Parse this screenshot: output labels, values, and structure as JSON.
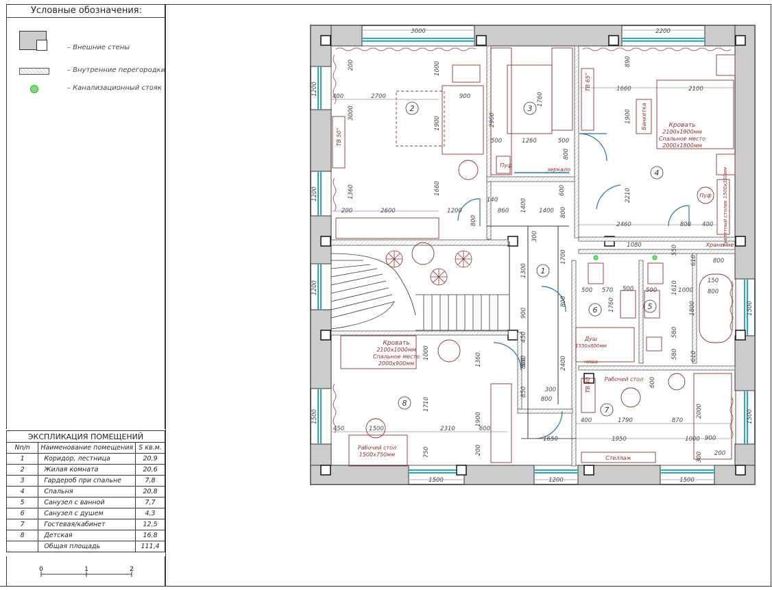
{
  "legend": {
    "title": "Условные обозначения:",
    "items": [
      {
        "symbol": "external-wall",
        "label": "– Внешние стены"
      },
      {
        "symbol": "internal-partition",
        "label": "– Внутренние перегородки"
      },
      {
        "symbol": "sewer-riser",
        "label": "– Канализационный стояк",
        "color": "#7be07b"
      }
    ]
  },
  "explication": {
    "caption": "ЭКСПЛИКАЦИЯ ПОМЕЩЕНИЙ",
    "headers": [
      "Nn/n",
      "Наименование помещения",
      "S кв.м."
    ],
    "rows": [
      {
        "n": "1",
        "name": "Коридор, лестница",
        "area": "20,9"
      },
      {
        "n": "2",
        "name": "Жилая комната",
        "area": "20,6"
      },
      {
        "n": "3",
        "name": "Гардероб при спальне",
        "area": "7,8"
      },
      {
        "n": "4",
        "name": "Спальня",
        "area": "20,8"
      },
      {
        "n": "5",
        "name": "Санузел с ванной",
        "area": "7,7"
      },
      {
        "n": "6",
        "name": "Санузел с душем",
        "area": "4,3"
      },
      {
        "n": "7",
        "name": "Гостевая/кабинет",
        "area": "12,5"
      },
      {
        "n": "8",
        "name": "Детская",
        "area": "16,8"
      }
    ],
    "total_label": "Общая площадь",
    "total_area": "111,4"
  },
  "scale": {
    "ticks": [
      "0",
      "1",
      "2"
    ]
  },
  "plan": {
    "room_numbers": [
      "1",
      "2",
      "3",
      "4",
      "5",
      "6",
      "7",
      "8"
    ],
    "labels": {
      "bed_master": [
        "Кровать",
        "2100х1900мм",
        "Спальное место",
        "2000х1800мм"
      ],
      "bed_child": [
        "Кровать",
        "2100х1000мм",
        "Спальное место",
        "2000х900мм"
      ],
      "desk_child": [
        "Рабочий стол",
        "1500х750мм"
      ],
      "desk_office": "Рабочий стол",
      "shower": [
        "Душ",
        "1550х800мм"
      ],
      "banquette": "Банкетка",
      "pouf1": "Пуф",
      "pouf2": "Пуф",
      "mirror": "зеркало",
      "storage": "Хранение",
      "shelving": "Стеллаж",
      "dresser": "Туалетный столик 1500х350мм",
      "tv50": "ТВ 50\"",
      "tv65": "ТВ 65\"",
      "tv40": "ТВ 40",
      "niche": "ниша"
    },
    "dims": {
      "top": [
        "3000",
        "2200"
      ],
      "bottom": [
        "1500",
        "1200",
        "1500"
      ],
      "left": [
        "1200",
        "1200",
        "1200",
        "1500"
      ],
      "right": [
        "1500",
        "1500"
      ],
      "room2": [
        "400",
        "2700",
        "900",
        "200",
        "1000",
        "3000",
        "1900",
        "1360",
        "1660",
        "200",
        "2600",
        "1200",
        "800",
        "140",
        "860"
      ],
      "room3": [
        "1760",
        "2960",
        "500",
        "1260",
        "500",
        "1400",
        "800"
      ],
      "room4": [
        "890",
        "1660",
        "2100",
        "1900",
        "2210",
        "2460",
        "800",
        "400",
        "1400",
        "600",
        "800"
      ],
      "corridor": [
        "300",
        "1700",
        "1300",
        "800",
        "900",
        "450",
        "2400",
        "800",
        "850",
        "300",
        "800",
        "1650",
        "1950",
        "1000"
      ],
      "baths": [
        "1080",
        "550",
        "610",
        "800",
        "500",
        "570",
        "500",
        "500",
        "1610",
        "150",
        "800",
        "1760",
        "1000",
        "1800",
        "580",
        "580",
        "610"
      ],
      "room7": [
        "600",
        "400",
        "1790",
        "870",
        "2000",
        "900",
        "200",
        "300"
      ],
      "room8": [
        "1000",
        "1360",
        "1710",
        "1900",
        "200",
        "450",
        "2310",
        "750",
        "1500",
        "600",
        "800"
      ]
    }
  }
}
